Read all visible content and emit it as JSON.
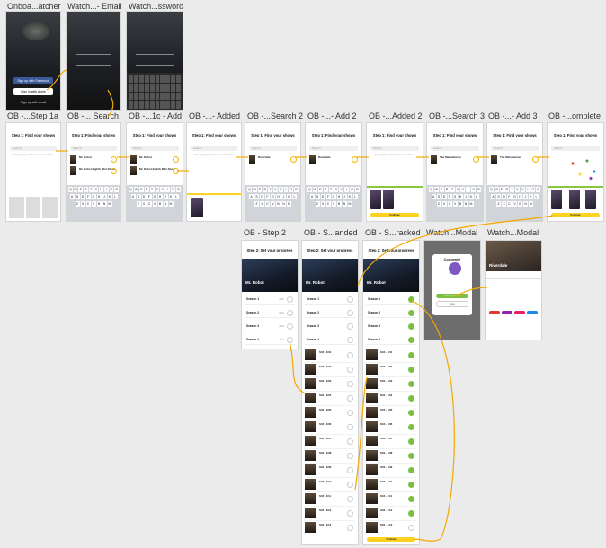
{
  "frame_labels": {
    "onboarding_watcher": "Onboa...atcher",
    "watch_email": "Watch...- Email",
    "watch_password": "Watch...ssword",
    "ob_step1a": "OB -...Step 1a",
    "ob_search": "OB -... Search",
    "ob_1c_add": "OB -...1c - Add",
    "ob_added": "OB -...- Added",
    "ob_search2": "OB -...Search 2",
    "ob_add2": "OB -...- Add 2",
    "ob_added2": "OB -...Added 2",
    "ob_search3": "OB -...Search 3",
    "ob_add3": "OB -...- Add 3",
    "ob_complete": "OB -...omplete",
    "ob_step2": "OB - Step 2",
    "ob_s_anded": "OB - S...anded",
    "ob_s_racked": "OB - S...racked",
    "watch_modal1": "Watch...Modal",
    "watch_modal2": "Watch...Modal"
  },
  "onboarding": {
    "facebook": "Sign up with Facebook",
    "apple": "Sign in with Apple",
    "email": "Sign up with email"
  },
  "step1": {
    "title": "Step 1: Find your shows",
    "search_placeholder": "Search",
    "hint": "Start typing to find your favorite shows"
  },
  "results": {
    "mr_robot": "Mr. Robot",
    "mr_robot_2": "Mr. Robot Eighth Mini Show",
    "riverdale": "Riverdale",
    "mandalorian": "The Mandalorian"
  },
  "complete_button": "Continue",
  "step2": {
    "title": "Step 2: Set your progress",
    "show_title": "Mr. Robot",
    "show_meta": "4 seasons · USA Network",
    "seasons": [
      "Season 1",
      "Season 2",
      "Season 3",
      "Season 4"
    ],
    "season_counts": [
      "0/10",
      "0/12",
      "0/10",
      "0/13"
    ]
  },
  "episodes": [
    "S04 - E01",
    "S04 - E02",
    "S04 - E03",
    "S04 - E04",
    "S04 - E05",
    "S04 - E06",
    "S04 - E07",
    "S04 - E08",
    "S04 - E09",
    "S04 - E10",
    "S04 - E11",
    "S04 - E12",
    "S04 - E13"
  ],
  "modal": {
    "title": "Congrats!",
    "primary": "Add more shows",
    "secondary": "Done"
  },
  "show_detail": {
    "title": "Riverdale"
  },
  "colors": {
    "accent": "#ffd21f",
    "connector": "#f2a900",
    "done": "#7bc043"
  }
}
